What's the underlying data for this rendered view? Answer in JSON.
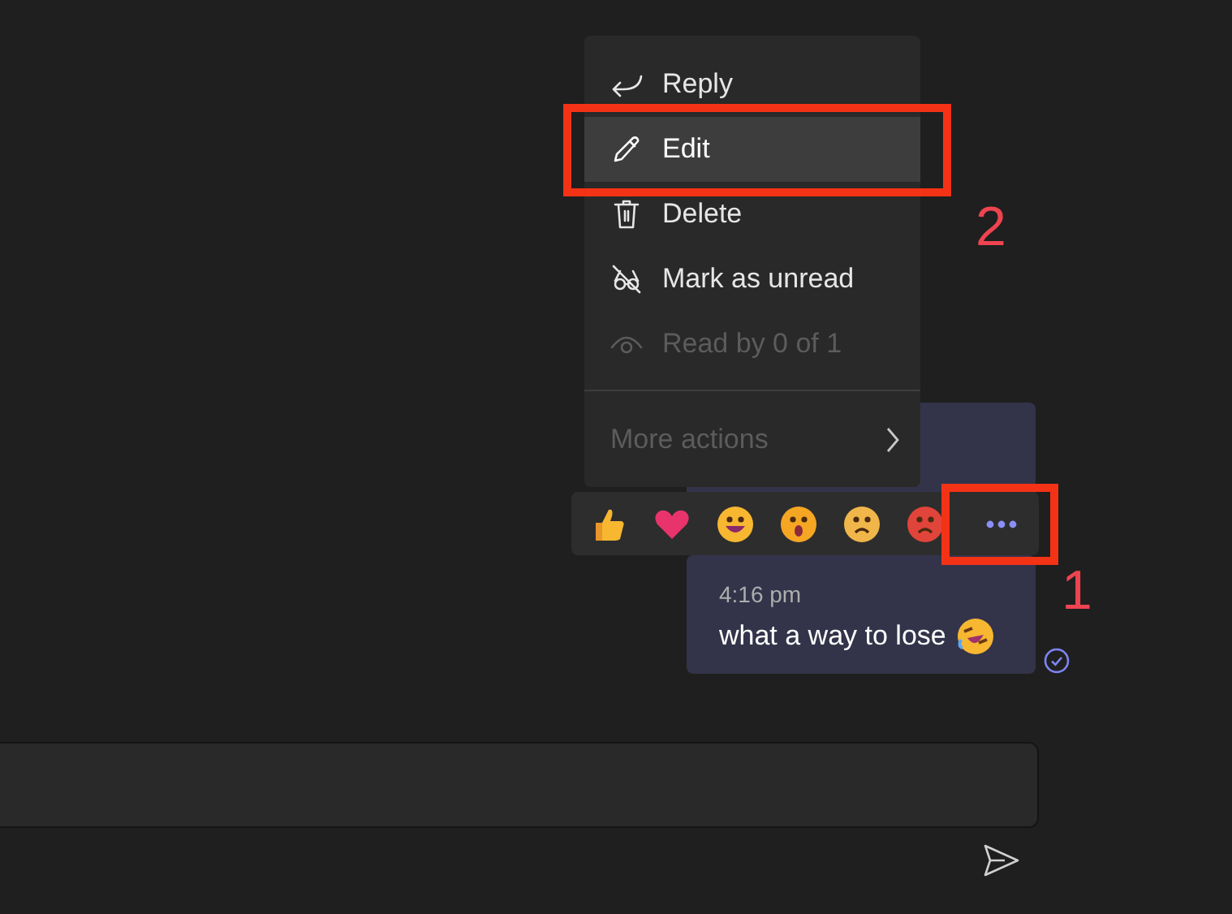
{
  "menu": {
    "items": [
      {
        "label": "Reply",
        "selected": false,
        "disabled": false
      },
      {
        "label": "Edit",
        "selected": true,
        "disabled": false
      },
      {
        "label": "Delete",
        "selected": false,
        "disabled": false
      },
      {
        "label": "Mark as unread",
        "selected": false,
        "disabled": false
      },
      {
        "label": "Read by 0 of 1",
        "selected": false,
        "disabled": true
      }
    ],
    "more_actions": {
      "label": "More actions",
      "disabled": true
    }
  },
  "message": {
    "time": "4:16 pm",
    "text": "what a way to lose"
  },
  "annotations": [
    {
      "label": "1"
    },
    {
      "label": "2"
    }
  ]
}
